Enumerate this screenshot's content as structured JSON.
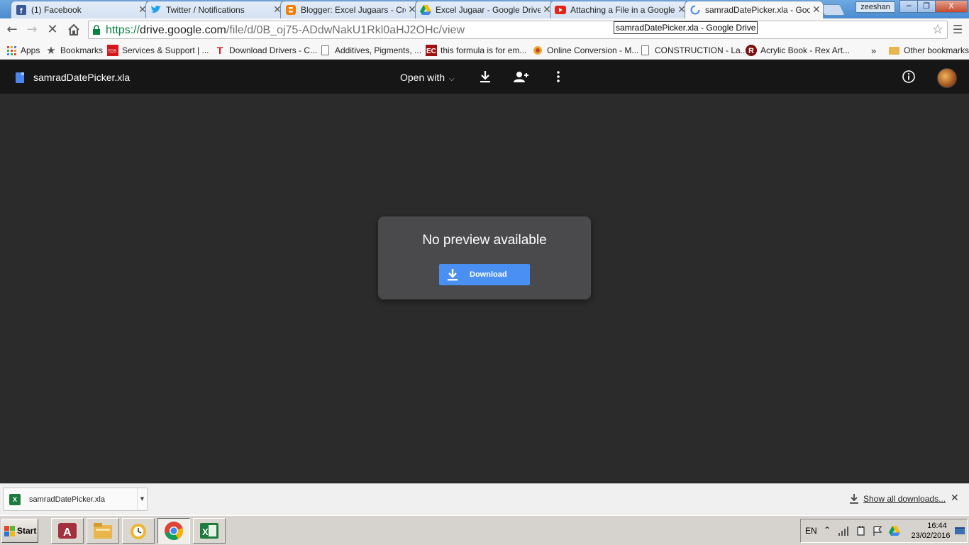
{
  "browser": {
    "tabs": [
      {
        "title": "(1) Facebook",
        "icon": "facebook-icon",
        "color": "#3b5998"
      },
      {
        "title": "Twitter / Notifications",
        "icon": "twitter-icon",
        "color": "#1da1f2"
      },
      {
        "title": "Blogger: Excel Jugaars - Cre",
        "icon": "blogger-icon",
        "color": "#f57d00"
      },
      {
        "title": "Excel Jugaar - Google Drive",
        "icon": "google-drive-icon",
        "color": "#0f9d58"
      },
      {
        "title": "Attaching a File in a Google",
        "icon": "youtube-icon",
        "color": "#e62117"
      },
      {
        "title": "samradDatePicker.xla - Goo",
        "icon": "loading-spinner-icon",
        "color": "#4a86f0"
      }
    ],
    "profile_name": "zeeshan",
    "window_controls": {
      "minimize": "─",
      "restore": "❐",
      "close": "X"
    },
    "url": {
      "scheme": "https://",
      "host": "drive.google.com",
      "path": "/file/d/0B_oj75-ADdwNakU1Rkl0aHJ2OHc/view"
    },
    "tooltip": "samradDatePicker.xla - Google Drive",
    "bookmarks": [
      {
        "label": "Apps",
        "icon": "apps-grid-icon"
      },
      {
        "label": "Bookmarks",
        "icon": "star-icon"
      },
      {
        "label": "Services & Support | ...",
        "icon": "tos-icon"
      },
      {
        "label": "Download Drivers - C...",
        "icon": "t-logo-icon"
      },
      {
        "label": "Additives, Pigments, ...",
        "icon": "page-icon"
      },
      {
        "label": "this formula is for em...",
        "icon": "ec-icon"
      },
      {
        "label": "Online Conversion - M...",
        "icon": "conversion-icon"
      },
      {
        "label": "CONSTRUCTION - La...",
        "icon": "page-icon"
      },
      {
        "label": "Acrylic Book - Rex Art...",
        "icon": "r-logo-icon"
      }
    ],
    "bookmarks_overflow": "»",
    "other_bookmarks": "Other bookmarks"
  },
  "viewer": {
    "file_name": "samradDatePicker.xla",
    "open_with_label": "Open with",
    "message": "No preview available",
    "download_label": "Download"
  },
  "download_shelf": {
    "file_name": "samradDatePicker.xla",
    "show_all_label": "Show all downloads...",
    "close_glyph": "✕"
  },
  "taskbar": {
    "start_label": "Start",
    "language": "EN",
    "time": "16:44",
    "date": "23/02/2016",
    "apps": [
      "access-icon",
      "file-explorer-icon",
      "outlook-icon",
      "chrome-icon",
      "excel-icon"
    ]
  }
}
